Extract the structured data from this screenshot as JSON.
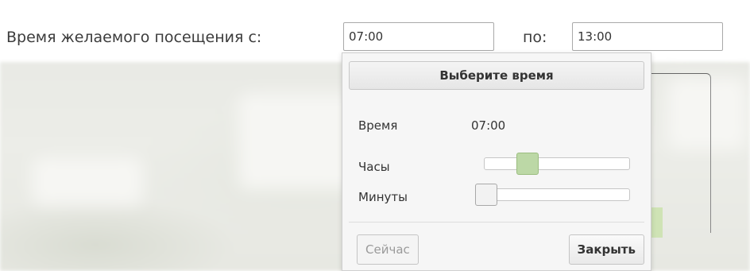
{
  "visit_time": {
    "label_from": "Время желаемого посещения с:",
    "from_value": "07:00",
    "label_to": "по:",
    "to_value": "13:00"
  },
  "time_picker": {
    "title": "Выберите время",
    "time_label": "Время",
    "time_value": "07:00",
    "hours_label": "Часы",
    "hours_value": 7,
    "minutes_label": "Минуты",
    "minutes_value": 0,
    "now_button": "Сейчас",
    "close_button": "Закрыть"
  },
  "colors": {
    "hours_handle": "#bcd8a6",
    "minutes_handle": "#f2f2f2"
  }
}
